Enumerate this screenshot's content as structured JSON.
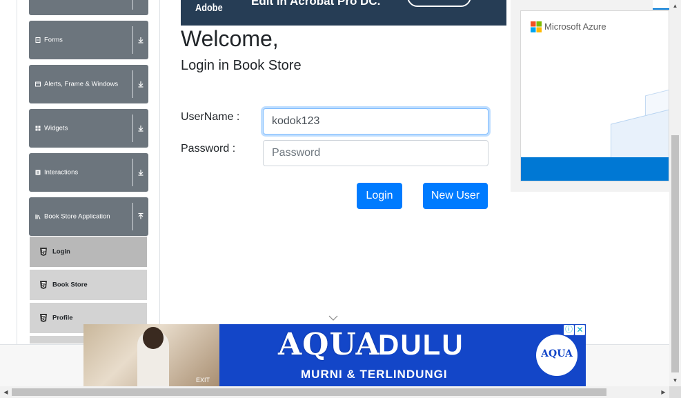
{
  "sidebar": {
    "groups": [
      {
        "label": "Forms",
        "icon": "form-icon",
        "expanded": false
      },
      {
        "label": "Alerts, Frame & Windows",
        "icon": "window-icon",
        "expanded": false
      },
      {
        "label": "Widgets",
        "icon": "widgets-icon",
        "expanded": false
      },
      {
        "label": "Interactions",
        "icon": "interactions-icon",
        "expanded": false
      },
      {
        "label": "Book Store Application",
        "icon": "book-store-icon",
        "expanded": true
      }
    ],
    "book_store_items": [
      {
        "label": "Login",
        "active": true
      },
      {
        "label": "Book Store",
        "active": false
      },
      {
        "label": "Profile",
        "active": false
      }
    ]
  },
  "top_ad": {
    "brand": "Adobe",
    "headline": "Edit in Acrobat Pro DC."
  },
  "main": {
    "welcome": "Welcome,",
    "subtitle": "Login in Book Store",
    "username_label": "UserName :",
    "username_value": "kodok123",
    "password_label": "Password :",
    "password_placeholder": "Password",
    "login_button": "Login",
    "new_user_button": "New User"
  },
  "right_ad": {
    "brand": "Microsoft Azure"
  },
  "bottom_ad": {
    "headline_1": "AQUA",
    "headline_2": "DULU",
    "tagline": "MURNI & TERLINDUNGI",
    "logo_text": "AQUA",
    "exit_text": "EXIT"
  },
  "colors": {
    "sidebar_group": "#6c757d",
    "primary": "#007bff",
    "aqua_blue": "#1346c8",
    "azure_blue": "#0078d4"
  }
}
